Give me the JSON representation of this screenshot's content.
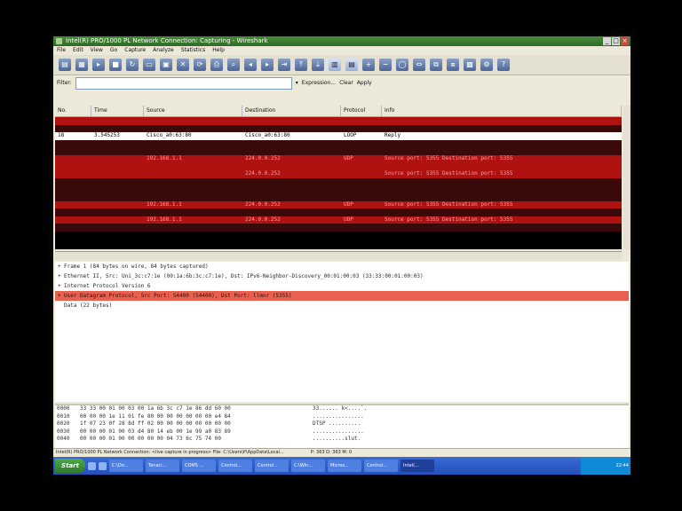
{
  "window": {
    "title": "Intel(R) PRO/1000 PL Network Connection: Capturing - Wireshark",
    "controls": [
      "_",
      "□",
      "×"
    ]
  },
  "menu": [
    "File",
    "Edit",
    "View",
    "Go",
    "Capture",
    "Analyze",
    "Statistics",
    "Help"
  ],
  "toolbar": {
    "icons": [
      "interface-list-icon",
      "capture-options-icon",
      "start-capture-icon",
      "stop-capture-icon",
      "restart-capture-icon",
      "open-file-icon",
      "save-file-icon",
      "close-file-icon",
      "reload-icon",
      "print-icon",
      "find-packet-icon",
      "go-back-icon",
      "go-forward-icon",
      "go-to-packet-icon",
      "go-first-icon",
      "go-last-icon",
      "colorize-icon",
      "auto-scroll-icon",
      "zoom-in-icon",
      "zoom-out-icon",
      "normal-size-icon",
      "resize-columns-icon",
      "capture-filters-icon",
      "display-filters-icon",
      "coloring-rules-icon",
      "preferences-icon",
      "help-icon"
    ]
  },
  "filter": {
    "label": "Filter:",
    "value": "",
    "expression": "Expression...",
    "clear": "Clear",
    "apply": "Apply"
  },
  "packet_list": {
    "columns": [
      "No.",
      "Time",
      "Source",
      "Destination",
      "Protocol",
      "Info"
    ],
    "rows": [
      {
        "style": "red",
        "no": "",
        "time": "",
        "source": "",
        "destination": "",
        "protocol": "",
        "info": ""
      },
      {
        "style": "dark",
        "no": "",
        "time": "",
        "source": "",
        "destination": "",
        "protocol": "",
        "info": ""
      },
      {
        "style": "white",
        "no": "18",
        "time": "3.545253",
        "source": "Cisco_a0:63:80",
        "destination": "Cisco_a0:63:80",
        "protocol": "LOOP",
        "info": "Reply"
      },
      {
        "style": "dark",
        "no": "",
        "time": "",
        "source": "",
        "destination": "",
        "protocol": "",
        "info": ""
      },
      {
        "style": "dark",
        "no": "",
        "time": "",
        "source": "",
        "destination": "",
        "protocol": "",
        "info": ""
      },
      {
        "style": "red",
        "no": "",
        "time": "",
        "source": "192.168.1.1",
        "destination": "224.0.0.252",
        "protocol": "UDP",
        "info": "Source port: 5355 Destination port: 5355"
      },
      {
        "style": "red",
        "no": "",
        "time": "",
        "source": "",
        "destination": "",
        "protocol": "",
        "info": ""
      },
      {
        "style": "red",
        "no": "",
        "time": "",
        "source": "",
        "destination": "224.0.0.252",
        "protocol": "",
        "info": "Source port: 5355 Destination port: 5355"
      },
      {
        "style": "dark",
        "no": "",
        "time": "",
        "source": "",
        "destination": "",
        "protocol": "",
        "info": ""
      },
      {
        "style": "dark",
        "no": "",
        "time": "",
        "source": "",
        "destination": "",
        "protocol": "",
        "info": ""
      },
      {
        "style": "dark",
        "no": "",
        "time": "",
        "source": "",
        "destination": "",
        "protocol": "",
        "info": ""
      },
      {
        "style": "red",
        "no": "",
        "time": "",
        "source": "192.168.1.1",
        "destination": "224.0.0.252",
        "protocol": "UDP",
        "info": "Source port: 5355 Destination port: 5355"
      },
      {
        "style": "dark",
        "no": "",
        "time": "",
        "source": "",
        "destination": "",
        "protocol": "",
        "info": ""
      },
      {
        "style": "red",
        "no": "",
        "time": "",
        "source": "192.168.1.1",
        "destination": "224.0.0.252",
        "protocol": "UDP",
        "info": "Source port: 5355 Destination port: 5355"
      },
      {
        "style": "dark",
        "no": "",
        "time": "",
        "source": "",
        "destination": "",
        "protocol": "",
        "info": ""
      }
    ]
  },
  "details": [
    {
      "text": "Frame 1 (84 bytes on wire, 84 bytes captured)",
      "exp": "+",
      "hl": false
    },
    {
      "text": "Ethernet II, Src: Uni_3c:c7:1e (00:1a:6b:3c:c7:1e), Dst: IPv6-Neighbor-Discovery_00:01:00:03 (33:33:00:01:00:03)",
      "exp": "+",
      "hl": false
    },
    {
      "text": "Internet Protocol Version 6",
      "exp": "+",
      "hl": false
    },
    {
      "text": "User Datagram Protocol, Src Port: 54400 (54400), Dst Port: llmnr (5355)",
      "exp": "+",
      "hl": true
    },
    {
      "text": "Data (22 bytes)",
      "exp": "",
      "hl": false
    }
  ],
  "hex_rows": [
    {
      "offset": "0000",
      "bytes": "33 33 00 01 00 03 00 1a  6b 3c c7 1e 86 dd 60 00",
      "ascii": "33...... k<....`."
    },
    {
      "offset": "0010",
      "bytes": "00 00 00 1e 11 01 fe 80  00 00 00 00 00 00 e4 84",
      "ascii": "................"
    },
    {
      "offset": "0020",
      "bytes": "1f 07 23 0f 28 8d ff 02  00 00 00 00 00 00 00 00",
      "ascii": "DTSP  .........."
    },
    {
      "offset": "0030",
      "bytes": "00 00 00 01 00 03 d4 80  14 eb 00 1e 99 a0 83 89",
      "ascii": "................"
    },
    {
      "offset": "0040",
      "bytes": "00 00 00 01 00 00 00 00  00 04 73 6c 75 74 00",
      "ascii": "..........slut."
    }
  ],
  "status": {
    "left": "Intel(R) PRO/1000 PL Network Connection: <live capture in progress> File: C:\\Users\\P\\AppData\\Local...",
    "right": "P: 363 D: 363 M: 0"
  },
  "taskbar": {
    "start": "Start",
    "tasks": [
      {
        "label": "C:\\Do...",
        "active": false
      },
      {
        "label": "Tenaci...",
        "active": false
      },
      {
        "label": "COM5 ...",
        "active": false
      },
      {
        "label": "Control...",
        "active": false
      },
      {
        "label": "Control...",
        "active": false
      },
      {
        "label": "C:\\Win...",
        "active": false
      },
      {
        "label": "Micros...",
        "active": false
      },
      {
        "label": "Control...",
        "active": false
      },
      {
        "label": "Intel(...",
        "active": true
      }
    ],
    "clock": "22:44"
  }
}
